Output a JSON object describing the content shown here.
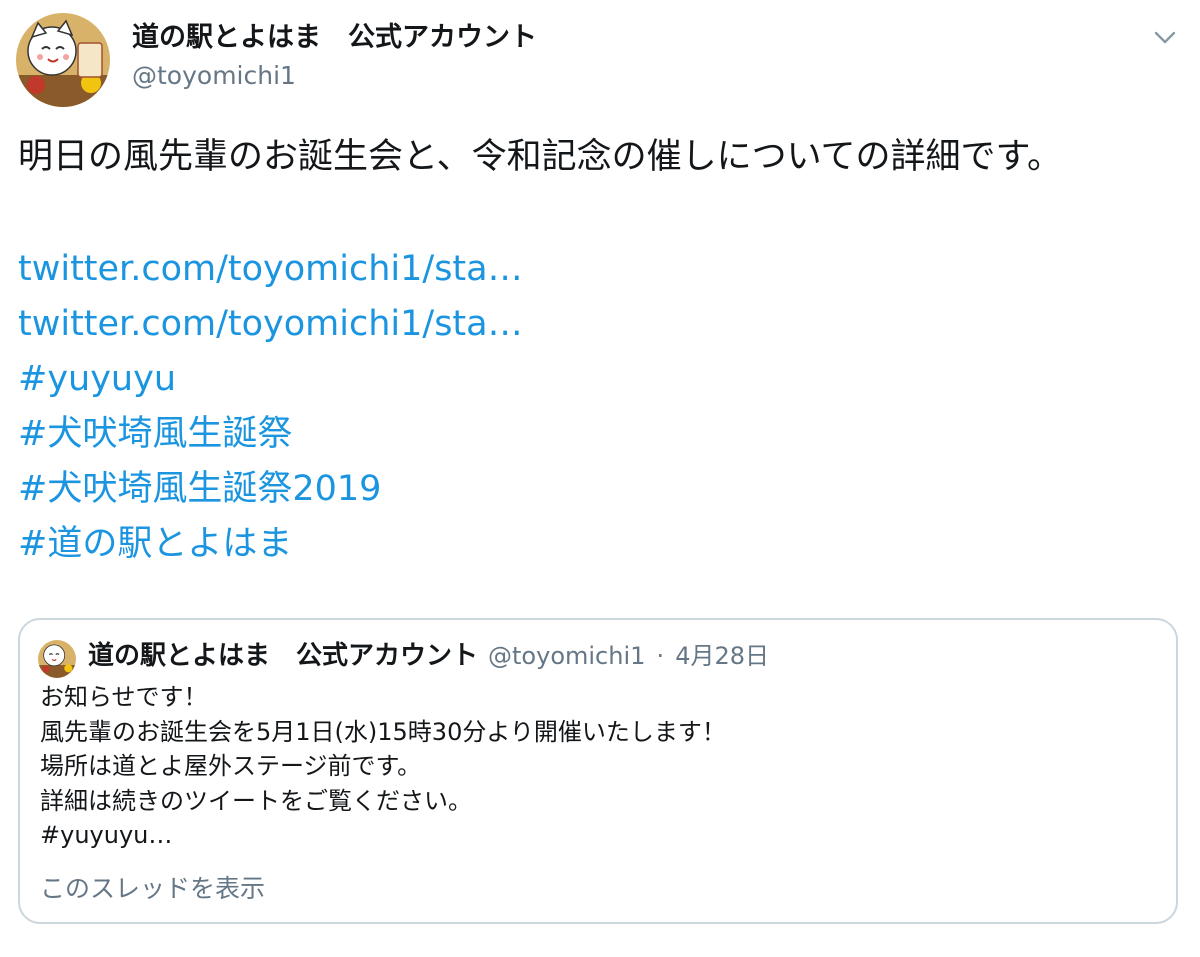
{
  "author": {
    "display_name": "道の駅とよはま　公式アカウント",
    "handle": "@toyomichi1"
  },
  "tweet": {
    "text": "明日の風先輩のお誕生会と、令和記念の催しについての詳細です。",
    "links": [
      "twitter.com/toyomichi1/sta…",
      "twitter.com/toyomichi1/sta…",
      "#yuyuyu",
      "#犬吠埼風生誕祭",
      "#犬吠埼風生誕祭2019",
      "#道の駅とよはま"
    ]
  },
  "quote": {
    "display_name": "道の駅とよはま　公式アカウント",
    "handle": "@toyomichi1",
    "separator": "·",
    "date": "4月28日",
    "lines": [
      "お知らせです！",
      "風先輩のお誕生会を5月1日(水)15時30分より開催いたします！",
      "場所は道とよ屋外ステージ前です。",
      "詳細は続きのツイートをご覧ください。",
      "#yuyuyu…"
    ],
    "show_thread": "このスレッドを表示"
  },
  "icons": {
    "menu": "chevron-down-icon",
    "avatar": "maneki-neko-avatar"
  },
  "colors": {
    "link": "#1b95e0",
    "secondary_text": "#657786",
    "border": "#ccd6dd",
    "primary_text": "#14171a"
  }
}
